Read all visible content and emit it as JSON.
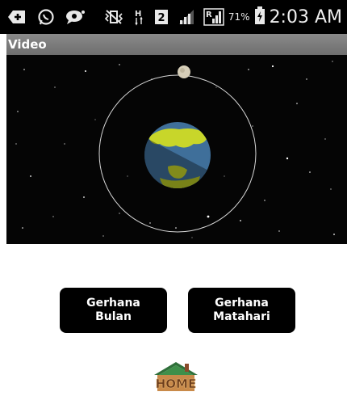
{
  "status_bar": {
    "icons": [
      "add-icon",
      "whatsapp-icon",
      "chat-bubble-icon",
      "vibrate-off-icon",
      "h-network-icon",
      "sim-2-icon",
      "signal-icon",
      "signal-roaming-icon",
      "battery-charging-icon"
    ],
    "sim_badge": "2",
    "network_type": "H",
    "roaming_letter": "R",
    "battery_percent": "71%",
    "time": "2:03 AM"
  },
  "title_bar": {
    "title": "Video"
  },
  "video": {
    "content": "earth-moon-orbit-animation",
    "colors": {
      "space": "#050505",
      "ocean": "#3f6f9a",
      "land": "#c8d62a",
      "moon": "#d6ceb8",
      "orbit": "#d8d8d8"
    }
  },
  "buttons": {
    "bulan": {
      "line1": "Gerhana",
      "line2": "Bulan"
    },
    "matahari": {
      "line1": "Gerhana",
      "line2": "Matahari"
    }
  },
  "home": {
    "label": "HOME",
    "icon": "home-house-icon"
  }
}
